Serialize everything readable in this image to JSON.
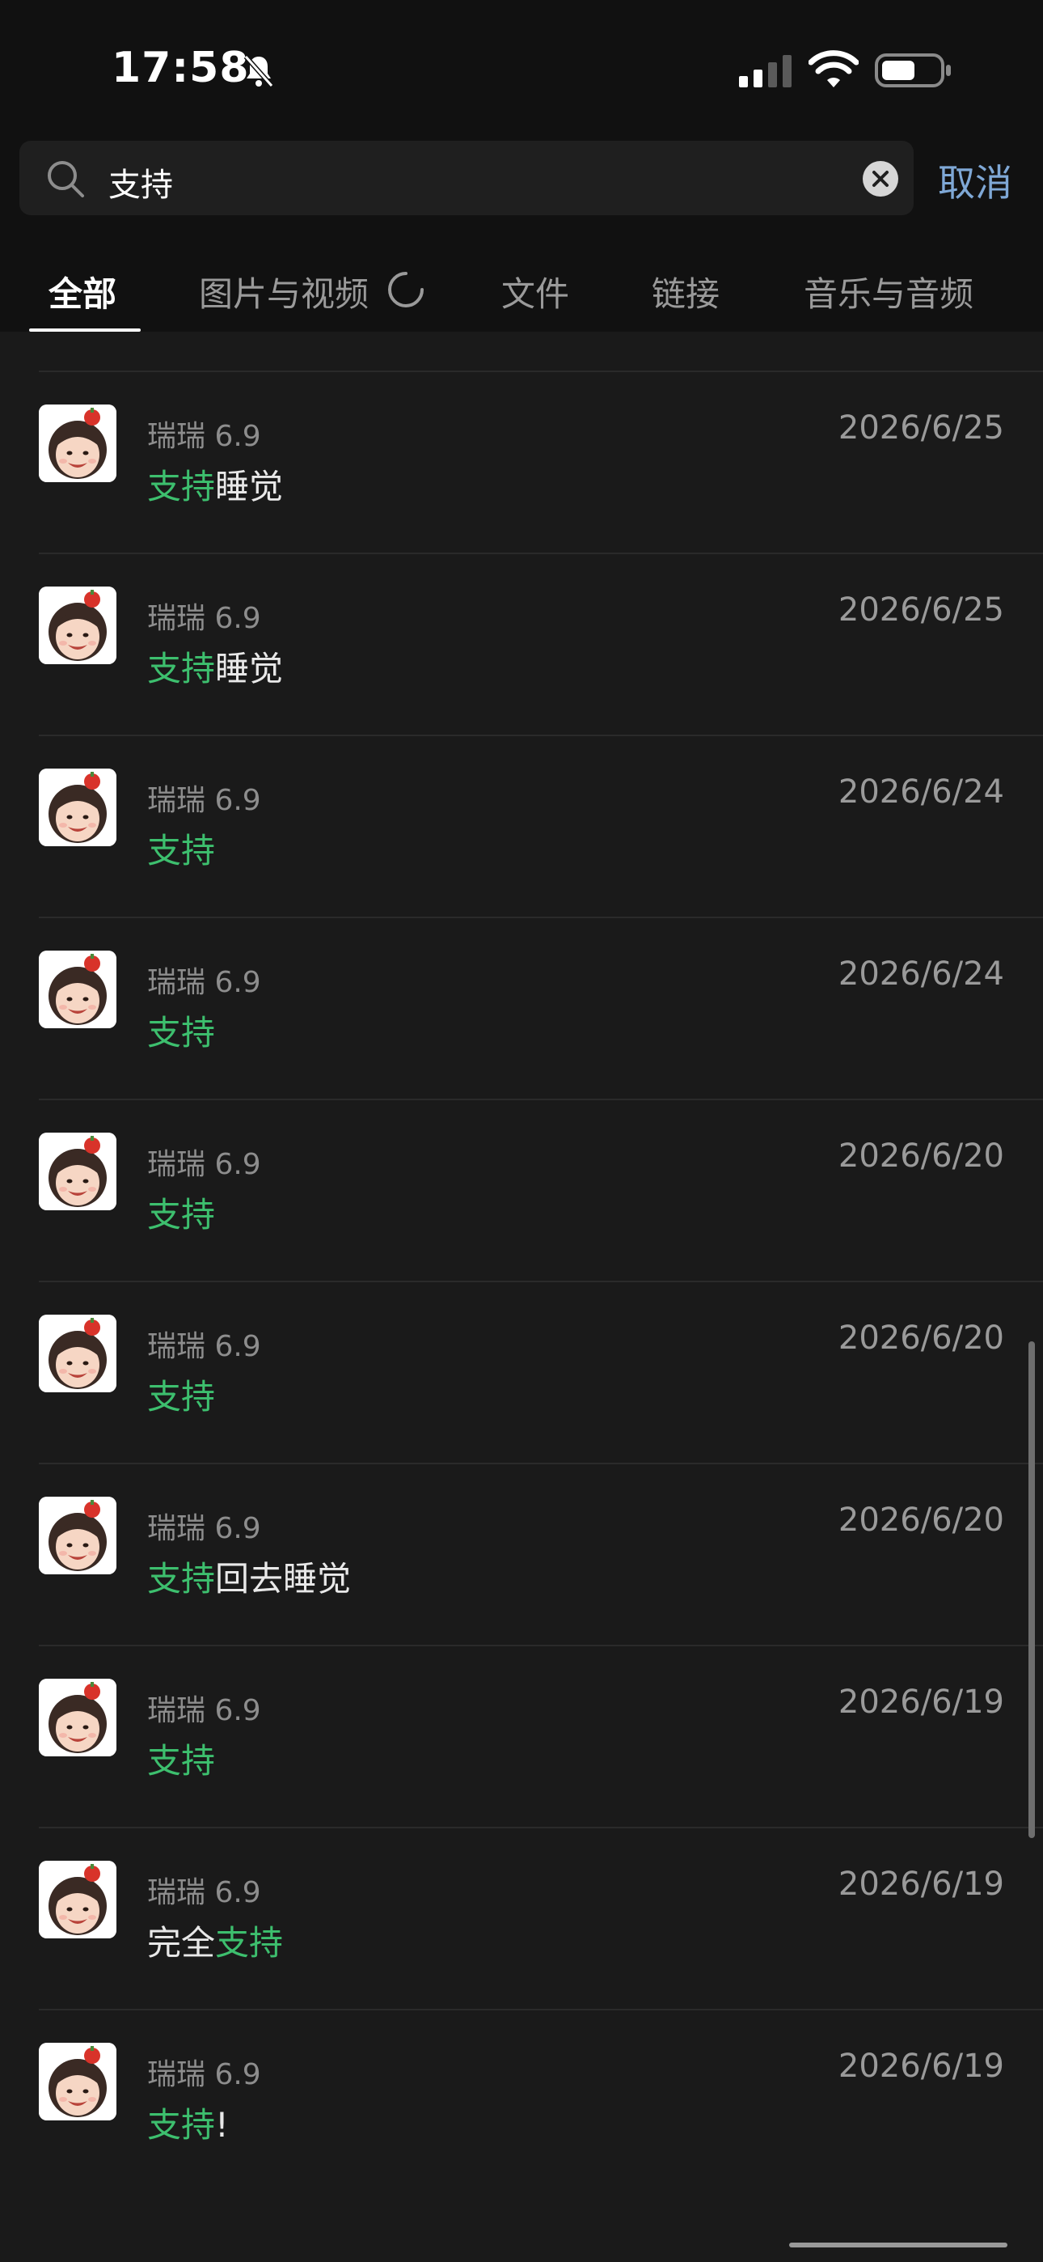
{
  "status_bar": {
    "time": "17:58",
    "icons": [
      "bell-slash-icon",
      "signal-icon",
      "wifi-icon",
      "battery-icon"
    ]
  },
  "search": {
    "query": "支持",
    "cancel_label": "取消"
  },
  "tabs": [
    {
      "label": "全部",
      "active": true
    },
    {
      "label": "图片与视频",
      "active": false
    },
    {
      "label": "文件",
      "active": false
    },
    {
      "label": "链接",
      "active": false
    },
    {
      "label": "音乐与音频",
      "active": false
    }
  ],
  "colors": {
    "highlight": "#3dbf6e",
    "link": "#7fa8d6",
    "background": "#1a1a1a"
  },
  "results": [
    {
      "sender": "",
      "date": "",
      "pre": "",
      "match": "支持",
      "post": ""
    },
    {
      "sender": "瑞瑞 6.9",
      "date": "2026/6/25",
      "pre": "",
      "match": "支持",
      "post": "睡觉"
    },
    {
      "sender": "瑞瑞 6.9",
      "date": "2026/6/25",
      "pre": "",
      "match": "支持",
      "post": "睡觉"
    },
    {
      "sender": "瑞瑞 6.9",
      "date": "2026/6/24",
      "pre": "",
      "match": "支持",
      "post": ""
    },
    {
      "sender": "瑞瑞 6.9",
      "date": "2026/6/24",
      "pre": "",
      "match": "支持",
      "post": ""
    },
    {
      "sender": "瑞瑞 6.9",
      "date": "2026/6/20",
      "pre": "",
      "match": "支持",
      "post": ""
    },
    {
      "sender": "瑞瑞 6.9",
      "date": "2026/6/20",
      "pre": "",
      "match": "支持",
      "post": ""
    },
    {
      "sender": "瑞瑞 6.9",
      "date": "2026/6/20",
      "pre": "",
      "match": "支持",
      "post": "回去睡觉"
    },
    {
      "sender": "瑞瑞 6.9",
      "date": "2026/6/19",
      "pre": "",
      "match": "支持",
      "post": ""
    },
    {
      "sender": "瑞瑞 6.9",
      "date": "2026/6/19",
      "pre": "完全",
      "match": "支持",
      "post": ""
    },
    {
      "sender": "瑞瑞 6.9",
      "date": "2026/6/19",
      "pre": "",
      "match": "支持",
      "post": "!"
    }
  ]
}
